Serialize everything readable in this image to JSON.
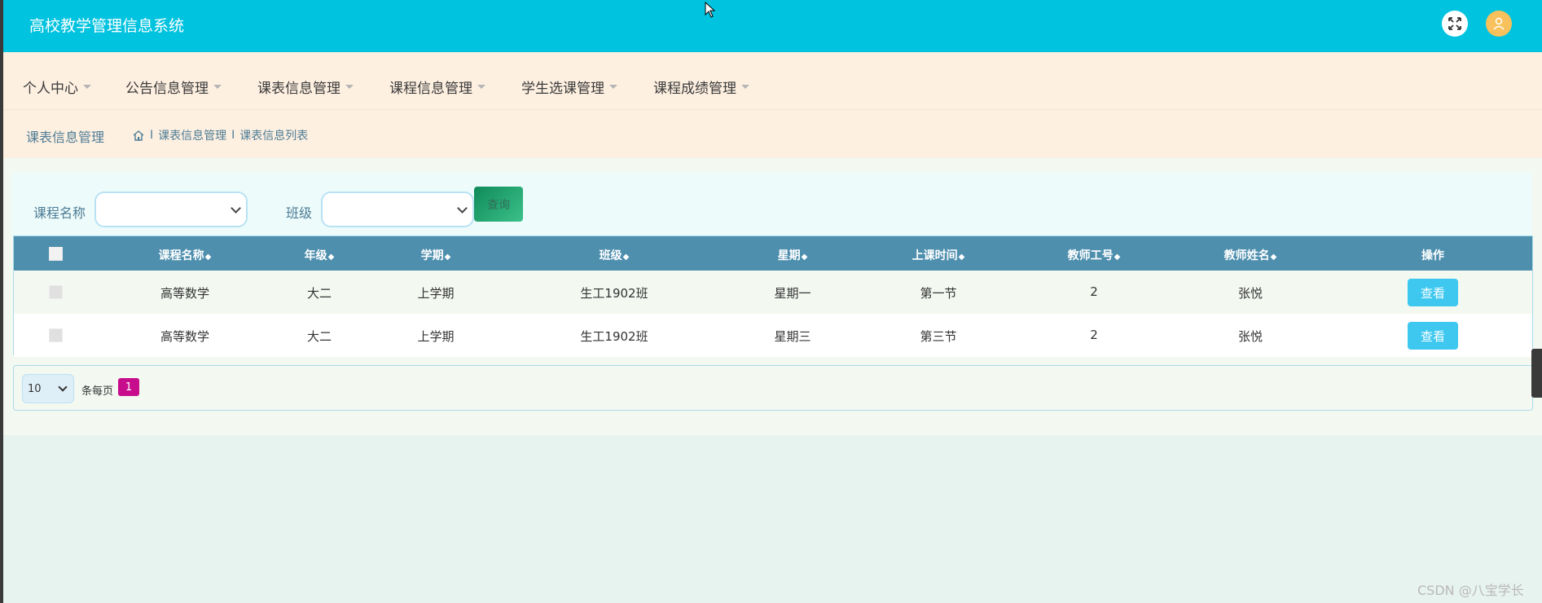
{
  "app": {
    "title": "高校教学管理信息系统"
  },
  "header": {
    "fullscreen_icon": "expand-icon",
    "avatar_icon": "user-icon",
    "avatar_color": "#f8c15b",
    "bar_color": "#00c3df"
  },
  "nav": {
    "items": [
      {
        "label": "个人中心"
      },
      {
        "label": "公告信息管理"
      },
      {
        "label": "课表信息管理"
      },
      {
        "label": "课程信息管理"
      },
      {
        "label": "学生选课管理"
      },
      {
        "label": "课程成绩管理"
      }
    ]
  },
  "breadcrumb": {
    "page_title": "课表信息管理",
    "home_icon": "home-icon",
    "items": [
      "课表信息管理",
      "课表信息列表"
    ],
    "separator": "I"
  },
  "search": {
    "course_label": "课程名称",
    "course_value": "",
    "class_label": "班级",
    "class_value": "",
    "query_label": "查询"
  },
  "table": {
    "columns": [
      "课程名称",
      "年级",
      "学期",
      "班级",
      "星期",
      "上课时间",
      "教师工号",
      "教师姓名",
      "操作"
    ],
    "sort_icon": "◆",
    "rows": [
      {
        "course": "高等数学",
        "grade": "大二",
        "term": "上学期",
        "class": "生工1902班",
        "weekday": "星期一",
        "time": "第一节",
        "teacher_id": "2",
        "teacher_name": "张悦",
        "action": "查看"
      },
      {
        "course": "高等数学",
        "grade": "大二",
        "term": "上学期",
        "class": "生工1902班",
        "weekday": "星期三",
        "time": "第三节",
        "teacher_id": "2",
        "teacher_name": "张悦",
        "action": "查看"
      }
    ],
    "header_color": "#4e8fae"
  },
  "pagination": {
    "page_size": "10",
    "per_page_label": "条每页",
    "current_page": "1"
  },
  "watermark": "CSDN @八宝学长"
}
